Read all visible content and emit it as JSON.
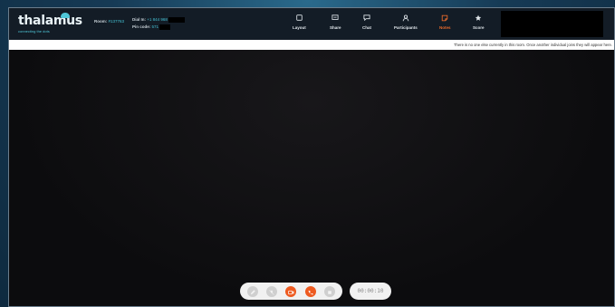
{
  "app": {
    "logo": "thalamus",
    "tagline": "connecting the dots"
  },
  "header": {
    "room_label": "Room:",
    "room_id": "#137763",
    "dial_label": "Dial In:",
    "dial_value": "+1 844 968",
    "pin_label": "Pin code:",
    "pin_value": "571"
  },
  "nav": [
    {
      "label": "Layout",
      "icon": "layout-icon"
    },
    {
      "label": "Share",
      "icon": "share-icon"
    },
    {
      "label": "Chat",
      "icon": "chat-icon"
    },
    {
      "label": "Participants",
      "icon": "participants-icon"
    },
    {
      "label": "Notes",
      "icon": "notes-icon",
      "active": true
    },
    {
      "label": "Score",
      "icon": "score-icon"
    }
  ],
  "notice": "There is no one else currently in this room. Once another individual joins they will appear here.",
  "controls": [
    {
      "name": "edit-icon"
    },
    {
      "name": "mute-mic-icon"
    },
    {
      "name": "camera-icon"
    },
    {
      "name": "end-call-icon"
    },
    {
      "name": "settings-icon"
    }
  ],
  "timer": "00:00:10",
  "colors": {
    "accent": "#46c3d6",
    "active": "#ea6a2b",
    "control_orange": "#ee5a20"
  }
}
